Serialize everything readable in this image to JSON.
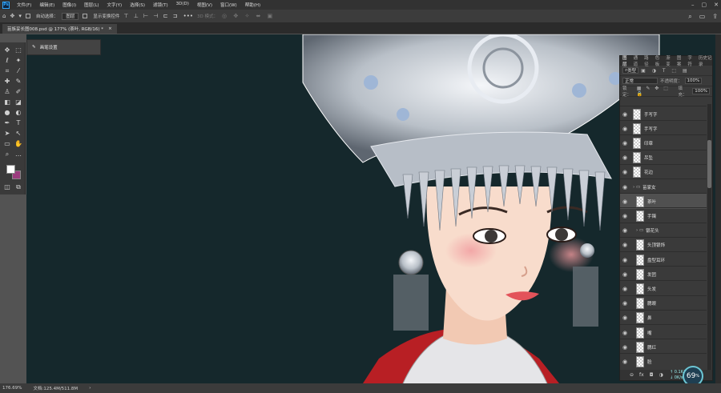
{
  "app": {
    "logo": "Ps",
    "accent": "#31a8ff"
  },
  "menu": [
    "文件(F)",
    "编辑(E)",
    "图像(I)",
    "图层(L)",
    "文字(Y)",
    "选择(S)",
    "滤镜(T)",
    "3D(D)",
    "视图(V)",
    "窗口(W)",
    "帮助(H)"
  ],
  "options": {
    "tool_icon": "move-icon",
    "auto_select_label": "自动选择：",
    "auto_select_value": "图层",
    "show_transform_label": "显示变换控件",
    "mode3d_label": "3D 模式："
  },
  "document_tab": {
    "title": "苗族妥长图008.psd @ 177% (茶叶, RGB/16) *",
    "close": "×"
  },
  "brush_panel": {
    "label": "画笔设置"
  },
  "colors": {
    "foreground": "#ffffff",
    "background": "#9b3c7e",
    "canvas": "#15282c"
  },
  "layers_panel": {
    "tabs": [
      "图层",
      "通道",
      "路径",
      "色板",
      "渐变",
      "图案",
      "字符",
      "历史记录"
    ],
    "active_tab": "图层",
    "filter_label": "类型",
    "blend_mode": "正常",
    "opacity_label": "不透明度：",
    "opacity_value": "100%",
    "lock_label": "锁定：",
    "fill_label": "填充：",
    "fill_value": "100%",
    "layers": [
      {
        "name": "手写字",
        "type": "layer"
      },
      {
        "name": "手写字",
        "type": "layer"
      },
      {
        "name": "印章",
        "type": "layer"
      },
      {
        "name": "吊坠",
        "type": "layer"
      },
      {
        "name": "花边",
        "type": "layer"
      },
      {
        "name": "苗家女",
        "type": "group"
      },
      {
        "name": "茶叶",
        "type": "layer",
        "selected": true
      },
      {
        "name": "手镯",
        "type": "layer"
      },
      {
        "name": "银花头",
        "type": "group"
      },
      {
        "name": "头顶银饰",
        "type": "layer"
      },
      {
        "name": "盘型耳环",
        "type": "layer"
      },
      {
        "name": "发团",
        "type": "layer"
      },
      {
        "name": "头发",
        "type": "layer"
      },
      {
        "name": "腮眼",
        "type": "layer"
      },
      {
        "name": "鼻",
        "type": "layer"
      },
      {
        "name": "嘴",
        "type": "layer"
      },
      {
        "name": "腮红",
        "type": "layer"
      },
      {
        "name": "脸",
        "type": "layer"
      }
    ]
  },
  "status": {
    "zoom": "176.69%",
    "doc_label": "文档:125.4M/511.8M"
  },
  "perf": {
    "value": "69",
    "unit": "%",
    "up": "0.1K/s",
    "down": "0K/s"
  }
}
